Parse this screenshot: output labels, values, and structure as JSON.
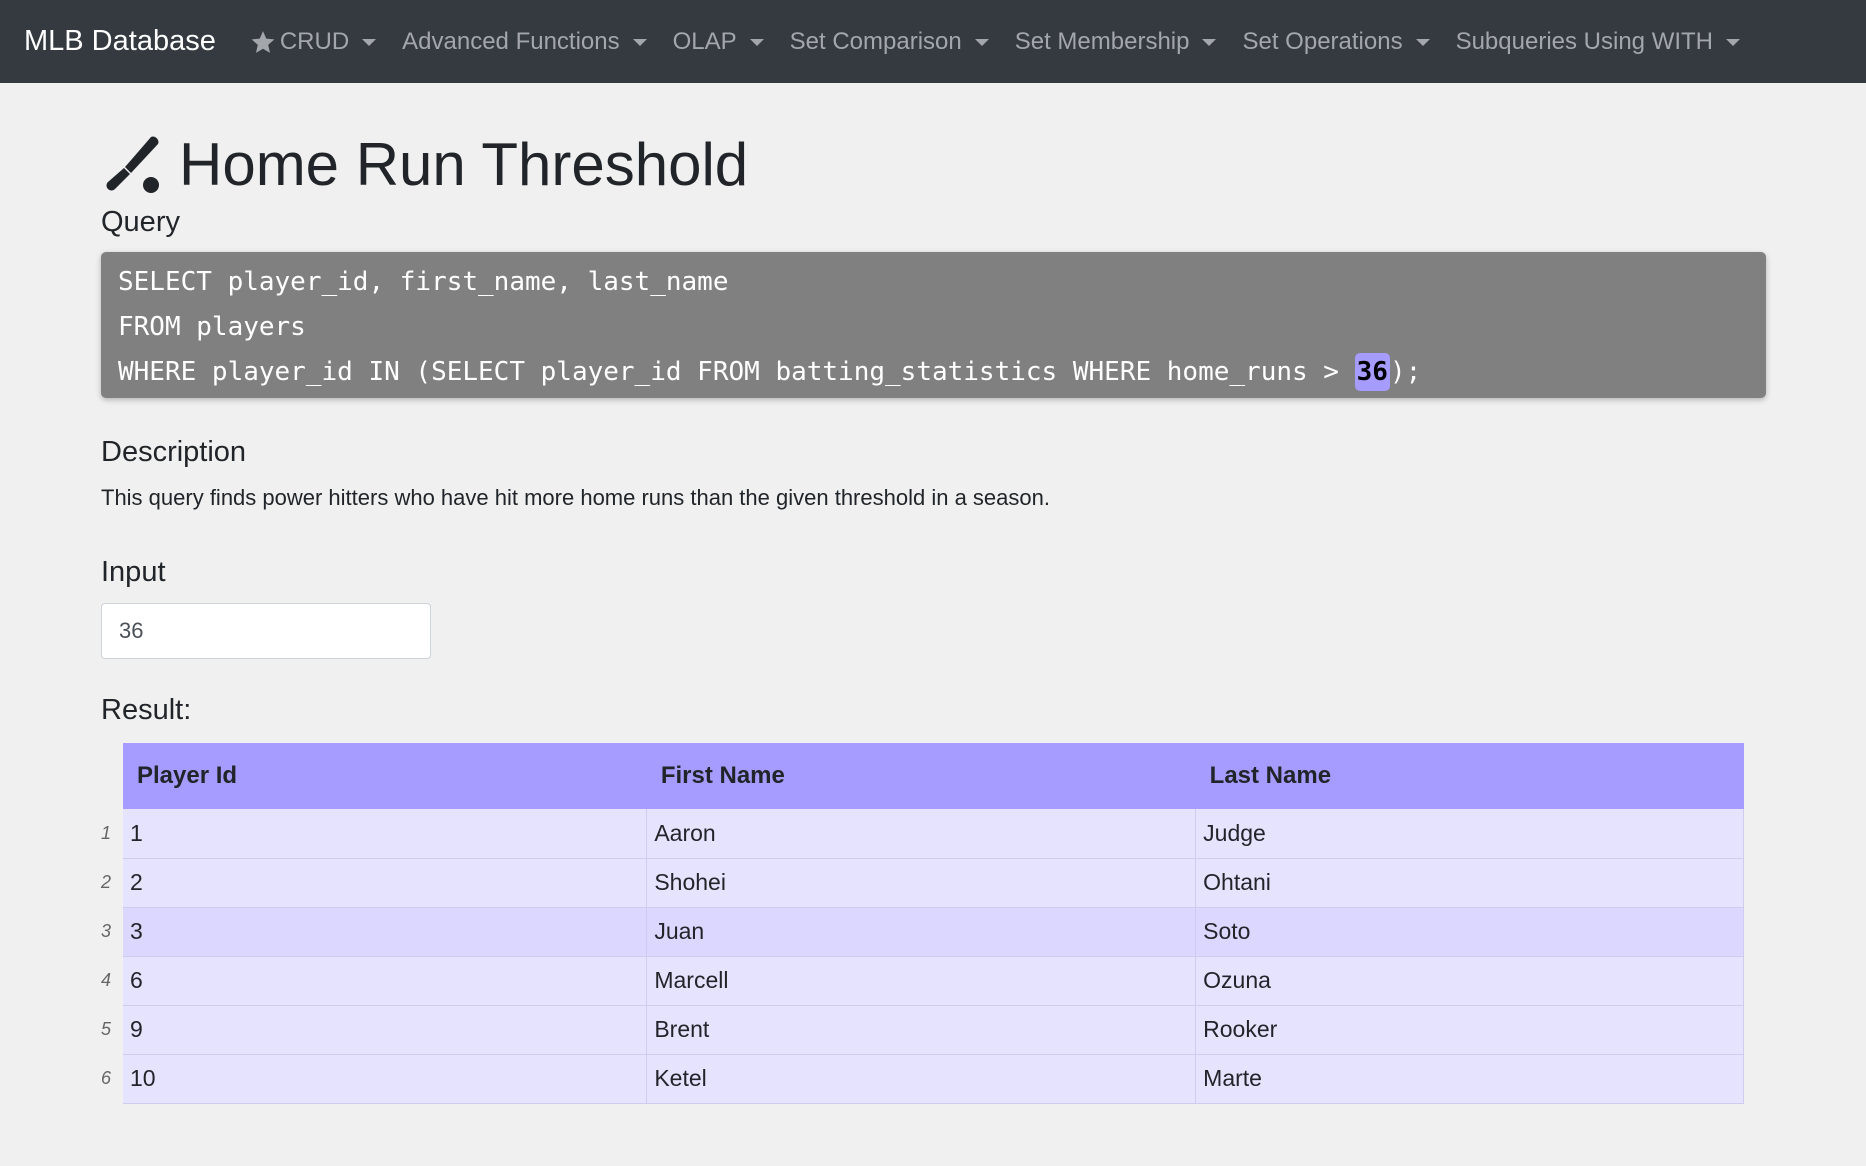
{
  "navbar": {
    "brand": "MLB Database",
    "items": [
      {
        "label": "CRUD",
        "icon": "star-icon"
      },
      {
        "label": "Advanced Functions"
      },
      {
        "label": "OLAP"
      },
      {
        "label": "Set Comparison"
      },
      {
        "label": "Set Membership"
      },
      {
        "label": "Set Operations"
      },
      {
        "label": "Subqueries Using WITH"
      }
    ]
  },
  "page": {
    "title": "Home Run Threshold",
    "title_icon": "baseball-bat-icon"
  },
  "query": {
    "label": "Query",
    "line1": "SELECT player_id, first_name, last_name",
    "line2": "FROM players",
    "line3_prefix": "WHERE player_id IN (SELECT player_id FROM batting_statistics WHERE home_runs > ",
    "line3_param": "36",
    "line3_suffix": ");"
  },
  "description": {
    "label": "Description",
    "text": "This query finds power hitters who have hit more home runs than the given threshold in a season."
  },
  "input": {
    "label": "Input",
    "value": "36"
  },
  "result": {
    "label": "Result:",
    "columns": [
      "Player Id",
      "First Name",
      "Last Name"
    ],
    "rows": [
      {
        "num": "1",
        "cells": [
          "1",
          "Aaron",
          "Judge"
        ]
      },
      {
        "num": "2",
        "cells": [
          "2",
          "Shohei",
          "Ohtani"
        ]
      },
      {
        "num": "3",
        "cells": [
          "3",
          "Juan",
          "Soto"
        ]
      },
      {
        "num": "4",
        "cells": [
          "6",
          "Marcell",
          "Ozuna"
        ]
      },
      {
        "num": "5",
        "cells": [
          "9",
          "Brent",
          "Rooker"
        ]
      },
      {
        "num": "6",
        "cells": [
          "10",
          "Ketel",
          "Marte"
        ]
      }
    ]
  },
  "colors": {
    "navbar_bg": "#343a40",
    "accent": "#a69cff",
    "query_bg": "#808080",
    "row_light": "#e6e3ff",
    "row_dark": "#dcd7ff"
  }
}
